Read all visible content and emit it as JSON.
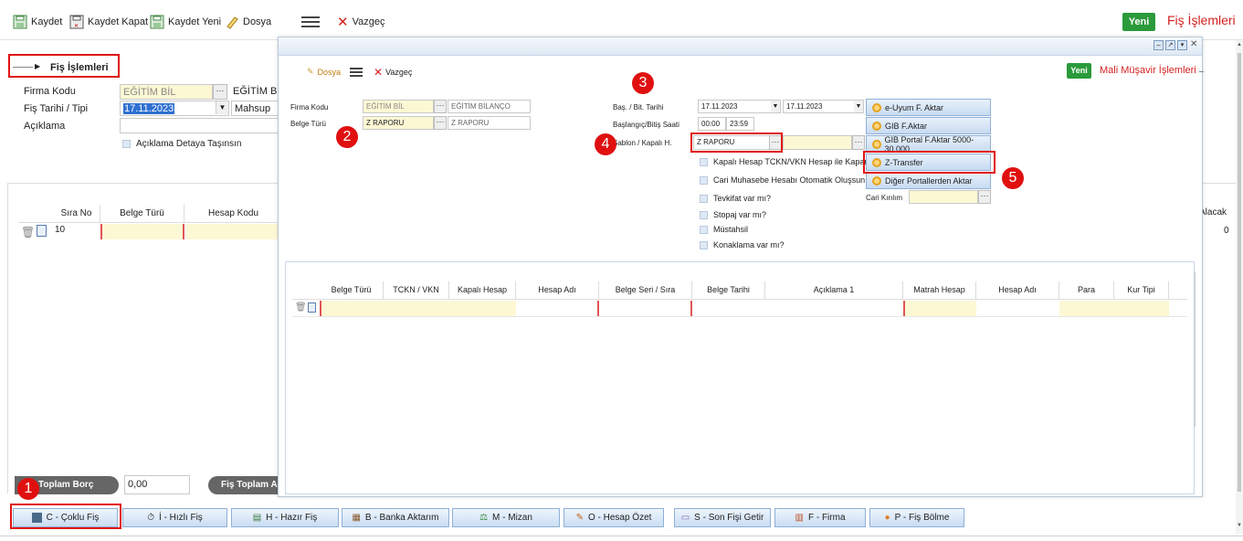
{
  "toolbar": {
    "save": "Kaydet",
    "save_close": "Kaydet Kapat",
    "save_new": "Kaydet Yeni",
    "file": "Dosya",
    "cancel": "Vazgeç",
    "new": "Yeni",
    "title": "Fiş İşlemleri"
  },
  "section": {
    "title": "Fiş İşlemleri"
  },
  "form": {
    "firma_label": "Firma Kodu",
    "firma_value": "EĞİTİM BİL",
    "firma_name": "EĞİTİM BİL",
    "date_label": "Fiş Tarihi / Tipi",
    "date_value": "17.11.2023",
    "type_value": "Mahsup",
    "desc_label": "Açıklama",
    "desc_check": "Açıklama Detaya Taşınsın"
  },
  "grid": {
    "columns": [
      "Sıra No",
      "Belge Türü",
      "Hesap Kodu"
    ],
    "row_value": "10",
    "right_col": "Alacak",
    "right_val": "0"
  },
  "totals": {
    "borc_label": "Toplam Borç",
    "borc_value": "0,00",
    "alacak_label": "Fiş Toplam Ala"
  },
  "bottom_tabs": [
    "C - Çoklu Fiş",
    "İ - Hızlı Fiş",
    "H - Hazır Fiş",
    "B - Banka Aktarım",
    "M - Mizan",
    "O - Hesap Özet",
    "S - Son Fişi Getir",
    "F - Firma",
    "P - Fiş Bölme"
  ],
  "modal": {
    "file": "Dosya",
    "cancel": "Vazgeç",
    "new": "Yeni",
    "title": "Mali Müşavir İşlemleri",
    "firma_label": "Firma Kodu",
    "firma_code": "EĞİTİM BİL",
    "firma_name": "EĞİTİM BİLANÇO",
    "belge_label": "Belge Türü",
    "belge_code": "Z RAPORU",
    "belge_name": "Z RAPORU",
    "date_label": "Baş. / Bit. Tarihi",
    "date_start": "17.11.2023",
    "date_end": "17.11.2023",
    "time_label": "Başlangıç/Bitiş Saati",
    "time_start": "00:00",
    "time_end": "23:59",
    "sablon_label": "Şablon / Kapalı H.",
    "sablon_value": "Z RAPORU",
    "checks": [
      "Kapalı Hesap TCKN/VKN Hesap ile Kapansın",
      "Cari Muhasebe Hesabı Otomatik Oluşsun",
      "Tevkifat var mı?",
      "Stopaj var mı?",
      "Müstahsil",
      "Konaklama var mı?"
    ],
    "cari_label": "Cari Kırılım",
    "buttons": [
      "e-Uyum F. Aktar",
      "GIB F.Aktar",
      "GIB Portal F.Aktar 5000-30.000",
      "Z-Transfer",
      "Diğer Portallerden Aktar"
    ],
    "table_cols": [
      "Belge Türü",
      "TCKN / VKN",
      "Kapalı Hesap",
      "Hesap Adı",
      "Belge Seri / Sıra",
      "Belge Tarihi",
      "Açıklama 1",
      "Matrah Hesap",
      "Hesap Adı",
      "Para",
      "Kur Tipi"
    ]
  },
  "badges": [
    "1",
    "2",
    "3",
    "4",
    "5"
  ],
  "colors": {
    "accent_red": "#e01010",
    "new_green": "#2a9a3a",
    "title_red": "#d42020"
  }
}
